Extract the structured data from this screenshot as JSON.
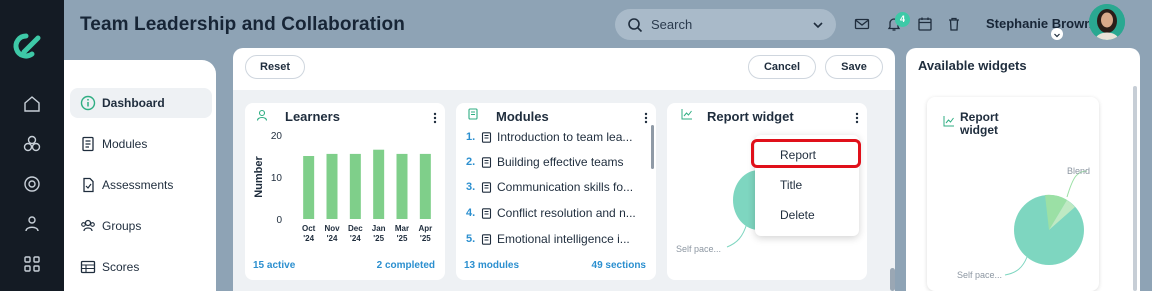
{
  "header": {
    "title": "Team Leadership and Collaboration",
    "search_placeholder": "Search",
    "notification_count": "4",
    "user_name": "Stephanie Brown"
  },
  "nav": {
    "items": [
      {
        "label": "Dashboard",
        "icon": "info-icon",
        "active": true
      },
      {
        "label": "Modules",
        "icon": "book-icon",
        "active": false
      },
      {
        "label": "Assessments",
        "icon": "document-check-icon",
        "active": false
      },
      {
        "label": "Groups",
        "icon": "users-icon",
        "active": false
      },
      {
        "label": "Scores",
        "icon": "table-icon",
        "active": false
      }
    ]
  },
  "toolbar": {
    "reset_label": "Reset",
    "cancel_label": "Cancel",
    "save_label": "Save"
  },
  "learners_widget": {
    "title": "Learners",
    "footer_left": "15 active",
    "footer_right": "2 completed"
  },
  "modules_widget": {
    "title": "Modules",
    "items": [
      {
        "num": "1.",
        "label": "Introduction to team lea..."
      },
      {
        "num": "2.",
        "label": "Building effective teams"
      },
      {
        "num": "3.",
        "label": "Communication skills fo..."
      },
      {
        "num": "4.",
        "label": "Conflict resolution and n..."
      },
      {
        "num": "5.",
        "label": "Emotional intelligence i..."
      }
    ],
    "footer_left": "13 modules",
    "footer_right": "49 sections"
  },
  "report_widget": {
    "title": "Report widget",
    "pie_label": "Self pace..."
  },
  "context_menu": {
    "items": [
      "Report",
      "Title",
      "Delete"
    ]
  },
  "available_widgets": {
    "title": "Available widgets",
    "card_title_line1": "Report",
    "card_title_line2": "widget",
    "pie_label_top": "Blend",
    "pie_label_bottom": "Self pace..."
  },
  "colors": {
    "accent_green": "#7fcf8a",
    "teal": "#7ed6c0",
    "link_blue": "#2b8fcf",
    "highlight_red": "#e0101a"
  },
  "chart_data": {
    "type": "bar",
    "categories": [
      "Oct '24",
      "Nov '24",
      "Dec '24",
      "Jan '25",
      "Mar '25",
      "Apr '25"
    ],
    "values": [
      15,
      15.5,
      15.5,
      16.5,
      15.5,
      15.5
    ],
    "ylabel": "Number",
    "ylim": [
      0,
      20
    ],
    "yticks": [
      0,
      10,
      20
    ],
    "grid": false
  }
}
